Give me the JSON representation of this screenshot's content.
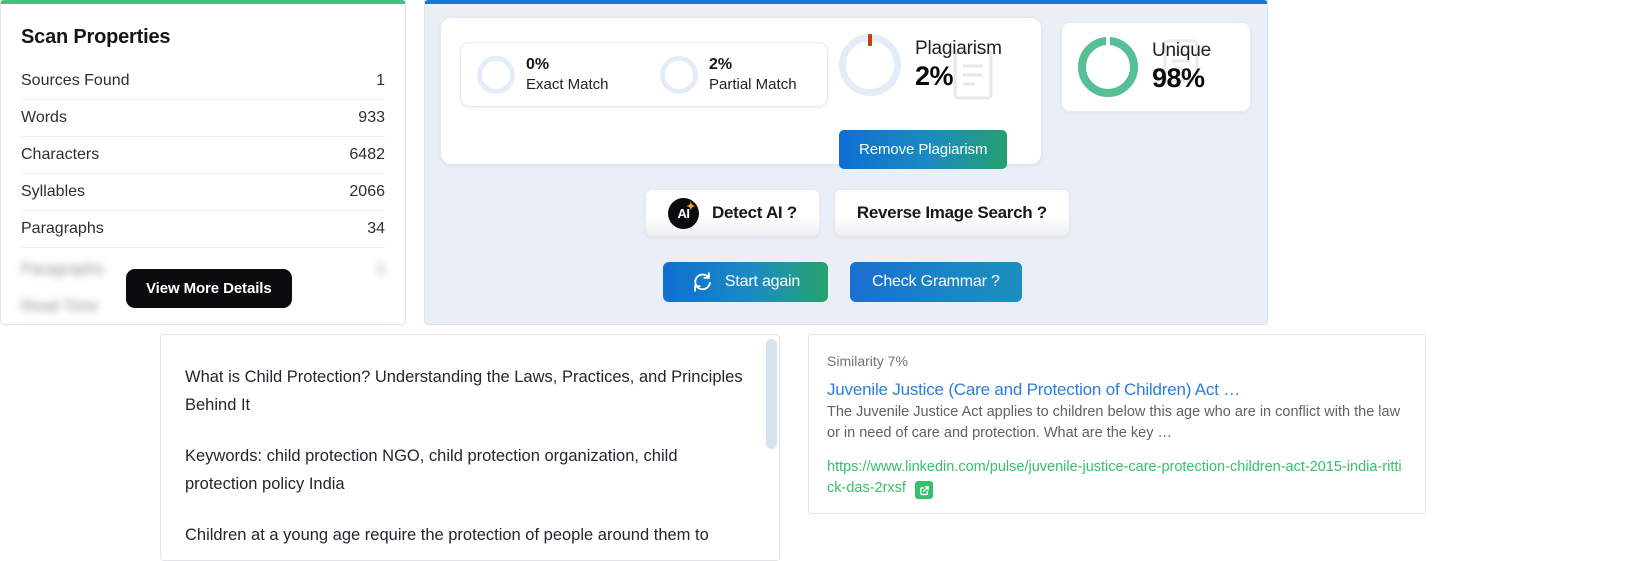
{
  "scan": {
    "title": "Scan Properties",
    "rows": [
      {
        "label": "Sources Found",
        "value": "1"
      },
      {
        "label": "Words",
        "value": "933"
      },
      {
        "label": "Characters",
        "value": "6482"
      },
      {
        "label": "Syllables",
        "value": "2066"
      },
      {
        "label": "Paragraphs",
        "value": "34"
      }
    ],
    "blurred_rows": [
      {
        "label": "Paragraphs",
        "value": "1"
      },
      {
        "label": "Read Time",
        "value": ""
      }
    ],
    "blurred_rows_right": [
      {
        "label": "Paragraphs",
        "value": ""
      },
      {
        "label": "Read Time",
        "value": ""
      }
    ],
    "view_more_label": "View More Details",
    "accent_color": "#3ec17d"
  },
  "plagiarism": {
    "accent_color": "#1478dd",
    "matches": [
      {
        "percent": "0%",
        "label": "Exact Match"
      },
      {
        "percent": "2%",
        "label": "Partial Match"
      }
    ],
    "gauge": {
      "name": "Plagiarism",
      "value": "2%"
    },
    "remove_label": "Remove Plagiarism",
    "unique": {
      "name": "Unique",
      "value": "98%",
      "color": "#55bf96"
    }
  },
  "actions": {
    "secondary": [
      {
        "label": "Detect AI ?",
        "icon": "ai-badge-icon"
      },
      {
        "label": "Reverse Image Search ?",
        "icon": ""
      }
    ],
    "primary": [
      {
        "label": "Start again",
        "icon": "refresh-icon"
      },
      {
        "label": "Check Grammar ?",
        "icon": ""
      }
    ]
  },
  "document": {
    "paragraphs": [
      "What is Child Protection? Understanding the Laws, Practices, and Principles Behind It",
      "Keywords: child protection NGO, child protection organization, child protection policy India",
      "Children at a young age require the protection of people around them to"
    ]
  },
  "source": {
    "similarity": "Similarity 7%",
    "title": "Juvenile Justice (Care and Protection of Children) Act …",
    "description": "The Juvenile Justice Act applies to children below this age who are in conflict with the law or in need of care and protection. What are the key …",
    "url": "https://www.linkedin.com/pulse/juvenile-justice-care-protection-children-act-2015-india-rittick-das-2rxsf",
    "link_color": "#35c06c",
    "external_icon": "external-link-icon"
  }
}
